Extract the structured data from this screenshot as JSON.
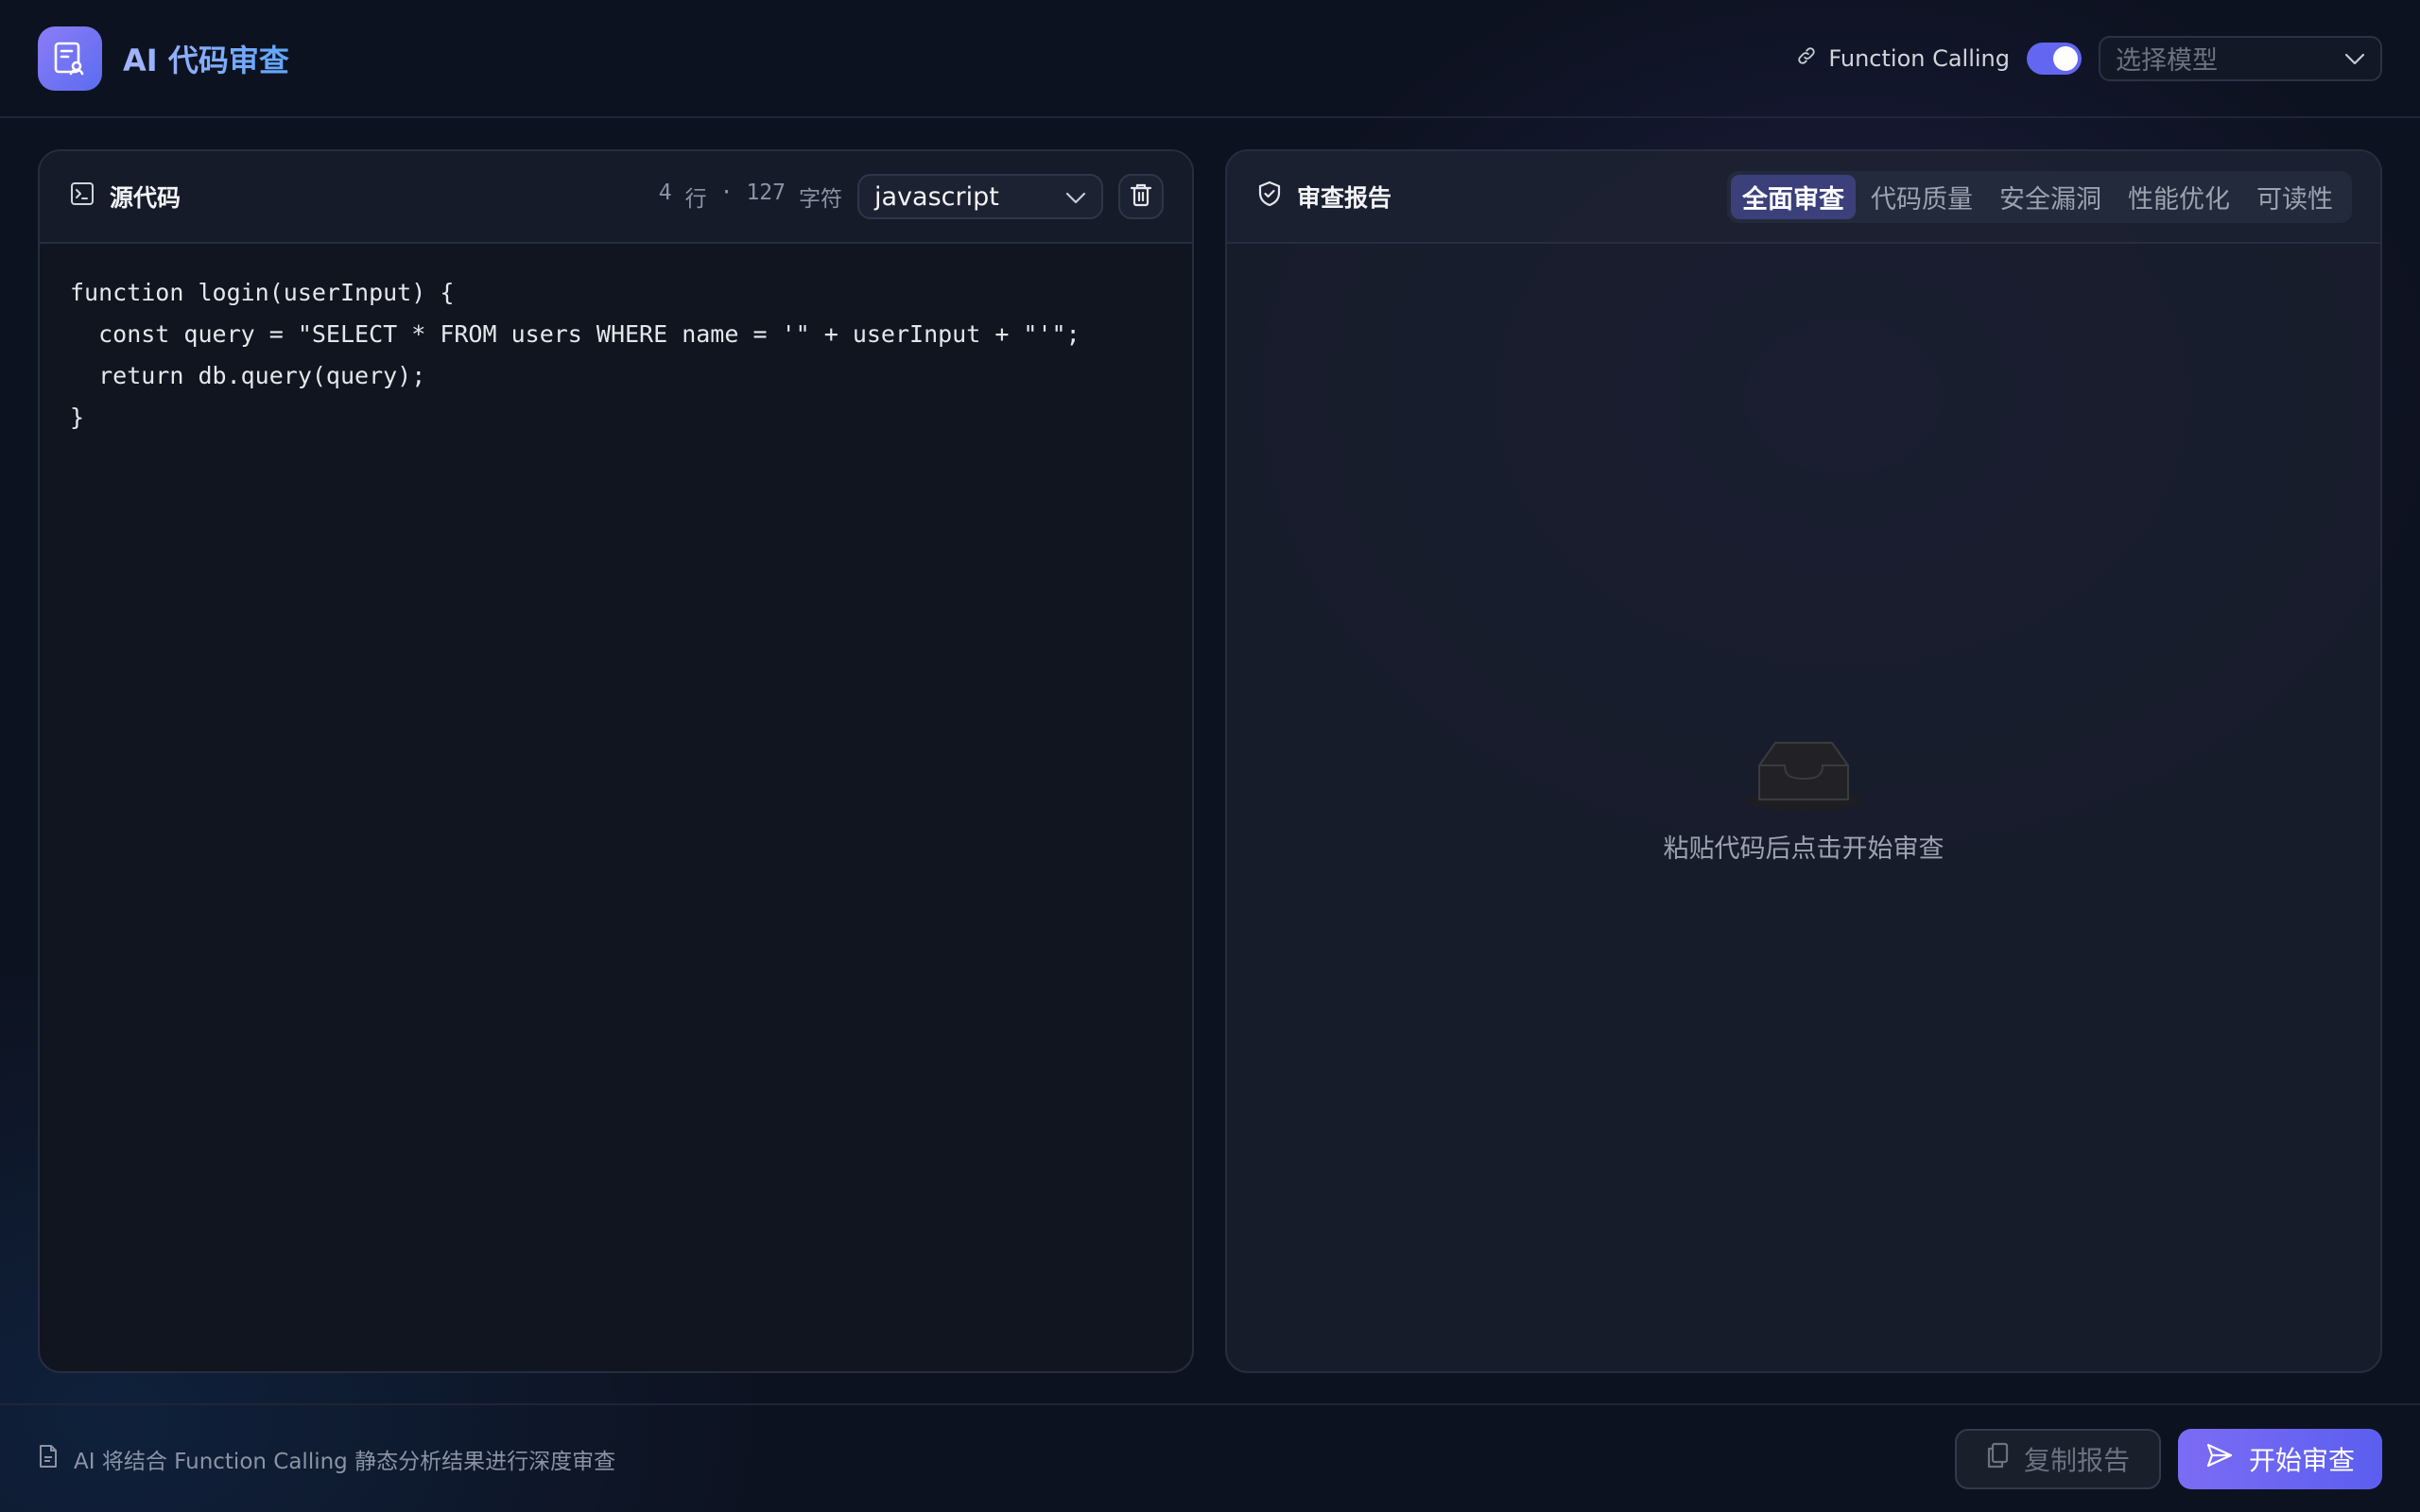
{
  "header": {
    "app_title": "AI 代码审查",
    "function_calling_label": "Function Calling",
    "function_calling_enabled": true,
    "model_select_placeholder": "选择模型"
  },
  "source_panel": {
    "title": "源代码",
    "line_count": "4",
    "line_unit": "行",
    "separator": "·",
    "char_count": "127",
    "char_unit": "字符",
    "language": "javascript",
    "code": "function login(userInput) {\n  const query = \"SELECT * FROM users WHERE name = '\" + userInput + \"'\";\n  return db.query(query);\n}"
  },
  "report_panel": {
    "title": "审查报告",
    "tabs": [
      {
        "label": "全面审查",
        "active": true
      },
      {
        "label": "代码质量",
        "active": false
      },
      {
        "label": "安全漏洞",
        "active": false
      },
      {
        "label": "性能优化",
        "active": false
      },
      {
        "label": "可读性",
        "active": false
      }
    ],
    "empty_message": "粘贴代码后点击开始审查"
  },
  "footer": {
    "note": "AI 将结合 Function Calling 静态分析结果进行深度审查",
    "copy_label": "复制报告",
    "start_label": "开始审查"
  },
  "colors": {
    "accent": "#6366f1",
    "background": "#0d1220"
  }
}
